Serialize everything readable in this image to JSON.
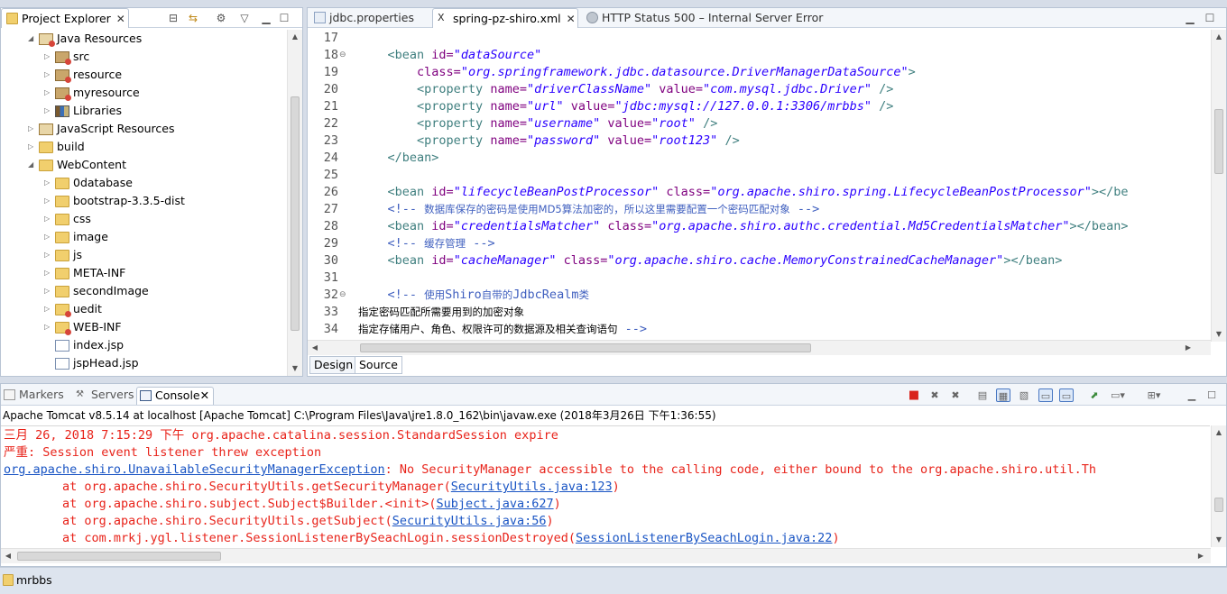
{
  "explorer": {
    "tab_title": "Project Explorer",
    "items": [
      {
        "label": "Java Resources",
        "depth": 1,
        "expanded": true,
        "icon": "java-resources-icon"
      },
      {
        "label": "src",
        "depth": 2,
        "expanded": false,
        "icon": "package-folder-icon"
      },
      {
        "label": "resource",
        "depth": 2,
        "expanded": false,
        "icon": "package-folder-icon"
      },
      {
        "label": "myresource",
        "depth": 2,
        "expanded": false,
        "icon": "package-folder-icon"
      },
      {
        "label": "Libraries",
        "depth": 2,
        "expanded": false,
        "icon": "libraries-icon"
      },
      {
        "label": "JavaScript Resources",
        "depth": 1,
        "expanded": false,
        "icon": "js-resources-icon"
      },
      {
        "label": "build",
        "depth": 1,
        "expanded": false,
        "icon": "folder-icon"
      },
      {
        "label": "WebContent",
        "depth": 1,
        "expanded": true,
        "icon": "folder-icon"
      },
      {
        "label": "0database",
        "depth": 2,
        "expanded": false,
        "icon": "folder-icon"
      },
      {
        "label": "bootstrap-3.3.5-dist",
        "depth": 2,
        "expanded": false,
        "icon": "folder-icon"
      },
      {
        "label": "css",
        "depth": 2,
        "expanded": false,
        "icon": "folder-icon"
      },
      {
        "label": "image",
        "depth": 2,
        "expanded": false,
        "icon": "folder-icon"
      },
      {
        "label": "js",
        "depth": 2,
        "expanded": false,
        "icon": "folder-icon"
      },
      {
        "label": "META-INF",
        "depth": 2,
        "expanded": false,
        "icon": "folder-icon"
      },
      {
        "label": "secondImage",
        "depth": 2,
        "expanded": false,
        "icon": "folder-icon"
      },
      {
        "label": "uedit",
        "depth": 2,
        "expanded": false,
        "icon": "folder-error-icon"
      },
      {
        "label": "WEB-INF",
        "depth": 2,
        "expanded": false,
        "icon": "folder-error-icon"
      },
      {
        "label": "index.jsp",
        "depth": 2,
        "expanded": null,
        "icon": "jsp-file-icon"
      },
      {
        "label": "jspHead.jsp",
        "depth": 2,
        "expanded": null,
        "icon": "jsp-file-icon"
      }
    ]
  },
  "editor": {
    "tabs": [
      {
        "label": "jdbc.properties",
        "active": false,
        "icon": "properties-file-icon"
      },
      {
        "label": "spring-pz-shiro.xml",
        "active": true,
        "icon": "xml-file-icon"
      },
      {
        "label": "HTTP Status 500 – Internal Server Error",
        "active": false,
        "icon": "browser-icon"
      }
    ],
    "lines": [
      {
        "n": "17",
        "fold": false,
        "parts": []
      },
      {
        "n": "18",
        "fold": true,
        "parts": [
          [
            "p",
            "    "
          ],
          [
            "t",
            "<bean "
          ],
          [
            "a",
            "id="
          ],
          [
            "v",
            "\"dataSource\""
          ]
        ]
      },
      {
        "n": "19",
        "fold": false,
        "parts": [
          [
            "p",
            "        "
          ],
          [
            "a",
            "class="
          ],
          [
            "v",
            "\"org.springframework.jdbc.datasource.DriverManagerDataSource\""
          ],
          [
            "t",
            ">"
          ]
        ]
      },
      {
        "n": "20",
        "fold": false,
        "parts": [
          [
            "p",
            "        "
          ],
          [
            "t",
            "<property "
          ],
          [
            "a",
            "name="
          ],
          [
            "v",
            "\"driverClassName\""
          ],
          [
            "p",
            " "
          ],
          [
            "a",
            "value="
          ],
          [
            "v",
            "\"com.mysql.jdbc.Driver\""
          ],
          [
            "t",
            " />"
          ]
        ]
      },
      {
        "n": "21",
        "fold": false,
        "parts": [
          [
            "p",
            "        "
          ],
          [
            "t",
            "<property "
          ],
          [
            "a",
            "name="
          ],
          [
            "v",
            "\"url\""
          ],
          [
            "p",
            " "
          ],
          [
            "a",
            "value="
          ],
          [
            "v",
            "\"jdbc:mysql://127.0.0.1:3306/mrbbs\""
          ],
          [
            "t",
            " />"
          ]
        ]
      },
      {
        "n": "22",
        "fold": false,
        "parts": [
          [
            "p",
            "        "
          ],
          [
            "t",
            "<property "
          ],
          [
            "a",
            "name="
          ],
          [
            "v",
            "\"username\""
          ],
          [
            "p",
            " "
          ],
          [
            "a",
            "value="
          ],
          [
            "v",
            "\"root\""
          ],
          [
            "t",
            " />"
          ]
        ]
      },
      {
        "n": "23",
        "fold": false,
        "parts": [
          [
            "p",
            "        "
          ],
          [
            "t",
            "<property "
          ],
          [
            "a",
            "name="
          ],
          [
            "v",
            "\"password\""
          ],
          [
            "p",
            " "
          ],
          [
            "a",
            "value="
          ],
          [
            "v",
            "\"root123\""
          ],
          [
            "t",
            " />"
          ]
        ]
      },
      {
        "n": "24",
        "fold": false,
        "parts": [
          [
            "p",
            "    "
          ],
          [
            "t",
            "</bean>"
          ]
        ]
      },
      {
        "n": "25",
        "fold": false,
        "parts": []
      },
      {
        "n": "26",
        "fold": false,
        "parts": [
          [
            "p",
            "    "
          ],
          [
            "t",
            "<bean "
          ],
          [
            "a",
            "id="
          ],
          [
            "v",
            "\"lifecycleBeanPostProcessor\""
          ],
          [
            "p",
            " "
          ],
          [
            "a",
            "class="
          ],
          [
            "v",
            "\"org.apache.shiro.spring.LifecycleBeanPostProcessor\""
          ],
          [
            "t",
            "></be"
          ]
        ]
      },
      {
        "n": "27",
        "fold": false,
        "parts": [
          [
            "p",
            "    "
          ],
          [
            "c",
            "<!-- "
          ],
          [
            "cn",
            "数据库保存的密码是使用MD5算法加密的，所以这里需要配置一个密码匹配对象"
          ],
          [
            "c",
            " -->"
          ]
        ]
      },
      {
        "n": "28",
        "fold": false,
        "parts": [
          [
            "p",
            "    "
          ],
          [
            "t",
            "<bean "
          ],
          [
            "a",
            "id="
          ],
          [
            "v",
            "\"credentialsMatcher\""
          ],
          [
            "p",
            " "
          ],
          [
            "a",
            "class="
          ],
          [
            "v",
            "\"org.apache.shiro.authc.credential.Md5CredentialsMatcher\""
          ],
          [
            "t",
            "></bean>"
          ]
        ]
      },
      {
        "n": "29",
        "fold": false,
        "parts": [
          [
            "p",
            "    "
          ],
          [
            "c",
            "<!-- "
          ],
          [
            "cn",
            "缓存管理"
          ],
          [
            "c",
            " -->"
          ]
        ]
      },
      {
        "n": "30",
        "fold": false,
        "parts": [
          [
            "p",
            "    "
          ],
          [
            "t",
            "<bean "
          ],
          [
            "a",
            "id="
          ],
          [
            "v",
            "\"cacheManager\""
          ],
          [
            "p",
            " "
          ],
          [
            "a",
            "class="
          ],
          [
            "v",
            "\"org.apache.shiro.cache.MemoryConstrainedCacheManager\""
          ],
          [
            "t",
            "></bean>"
          ]
        ]
      },
      {
        "n": "31",
        "fold": false,
        "parts": []
      },
      {
        "n": "32",
        "fold": true,
        "parts": [
          [
            "p",
            "    "
          ],
          [
            "c",
            "<!-- "
          ],
          [
            "cn",
            "使用"
          ],
          [
            "c",
            "Shiro"
          ],
          [
            "cn",
            "自带的"
          ],
          [
            "c",
            "JdbcRealm"
          ],
          [
            "cn",
            "类"
          ]
        ]
      },
      {
        "n": "33",
        "fold": false,
        "parts": [
          [
            "cn",
            "指定密码匹配所需要用到的加密对象"
          ]
        ]
      },
      {
        "n": "34",
        "fold": false,
        "parts": [
          [
            "cn",
            "指定存储用户、角色、权限许可的数据源及相关查询语句"
          ],
          [
            "c",
            " -->"
          ]
        ]
      }
    ],
    "mode_tabs": [
      "Design",
      "Source"
    ]
  },
  "console": {
    "tabs": [
      {
        "label": "Markers",
        "active": false,
        "icon": "markers-icon"
      },
      {
        "label": "Servers",
        "active": false,
        "icon": "servers-icon"
      },
      {
        "label": "Console",
        "active": true,
        "icon": "console-icon"
      }
    ],
    "process_label": "Apache Tomcat v8.5.14 at localhost [Apache Tomcat] C:\\Program Files\\Java\\jre1.8.0_162\\bin\\javaw.exe (2018年3月26日 下午1:36:55)",
    "lines": [
      [
        [
          "cn",
          "三月"
        ],
        [
          "p",
          " 26, 2018 7:15:29 "
        ],
        [
          "cn",
          "下午"
        ],
        [
          "p",
          " org.apache.catalina.session.StandardSession expire"
        ]
      ],
      [
        [
          "cn",
          "严重"
        ],
        [
          "p",
          ": Session event listener threw exception"
        ]
      ],
      [
        [
          "l",
          "org.apache.shiro.UnavailableSecurityManagerException"
        ],
        [
          "p",
          ": No SecurityManager accessible to the calling code, either bound to the org.apache.shiro.util.Th"
        ]
      ],
      [
        [
          "p",
          "\tat org.apache.shiro.SecurityUtils.getSecurityManager("
        ],
        [
          "l",
          "SecurityUtils.java:123"
        ],
        [
          "p",
          ")"
        ]
      ],
      [
        [
          "p",
          "\tat org.apache.shiro.subject.Subject$Builder.<init>("
        ],
        [
          "l",
          "Subject.java:627"
        ],
        [
          "p",
          ")"
        ]
      ],
      [
        [
          "p",
          "\tat org.apache.shiro.SecurityUtils.getSubject("
        ],
        [
          "l",
          "SecurityUtils.java:56"
        ],
        [
          "p",
          ")"
        ]
      ],
      [
        [
          "p",
          "\tat com.mrkj.ygl.listener.SessionListenerBySeachLogin.sessionDestroyed("
        ],
        [
          "l",
          "SessionListenerBySeachLogin.java:22"
        ],
        [
          "p",
          ")"
        ]
      ]
    ]
  },
  "status": {
    "label": "mrbbs"
  }
}
